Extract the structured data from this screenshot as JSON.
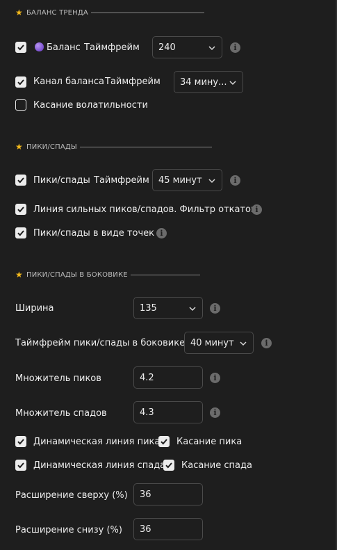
{
  "sections": {
    "trend_balance": "БАЛАНС ТРЕНДА",
    "peaks_troughs": "ПИКИ/СПАДЫ",
    "peaks_troughs_side": "ПИКИ/СПАДЫ В БОКОВИКЕ"
  },
  "rows": {
    "balance": {
      "label": "Баланс",
      "tf_label": "Таймфрейм",
      "value": "240",
      "checked": true
    },
    "balance_channel": {
      "label": "Канал баланса",
      "tf_label": "Таймфрейм",
      "value": "34 мину...",
      "checked": true
    },
    "volatility_touch": {
      "label": "Касание волатильности",
      "checked": false
    },
    "peaks": {
      "label": "Пики/спады",
      "tf_label": "Таймфрейм",
      "value": "45 минут",
      "checked": true
    },
    "strong_peaks": {
      "label": "Линия сильных пиков/спадов. Фильтр откатов",
      "checked": true
    },
    "peaks_dots": {
      "label": "Пики/спады в виде точек",
      "checked": true
    },
    "width": {
      "label": "Ширина",
      "value": "135"
    },
    "side_tf": {
      "label": "Таймфрейм пики/спады в боковике",
      "value": "40 минут"
    },
    "peak_mult": {
      "label": "Множитель пиков",
      "value": "4.2"
    },
    "trough_mult": {
      "label": "Множитель спадов",
      "value": "4.3"
    },
    "dyn_peak": {
      "label": "Динамическая линия пика",
      "checked": true
    },
    "peak_touch": {
      "label": "Касание пика",
      "checked": true
    },
    "dyn_trough": {
      "label": "Динамическая линия спада",
      "checked": true
    },
    "trough_touch": {
      "label": "Касание спада",
      "checked": true
    },
    "ext_top": {
      "label": "Расширение сверху (%)",
      "value": "36"
    },
    "ext_bottom": {
      "label": "Расширение снизу (%)",
      "value": "36"
    }
  },
  "icons": {
    "star": "star-icon",
    "info": "info-icon",
    "chevron": "chevron-down-icon",
    "check": "check-icon",
    "dot": "purple-dot-icon"
  },
  "colors": {
    "background": "#1e1e1e",
    "star": "#f2b81c",
    "dot": "#8a5cd9",
    "info": "#6b6b6b"
  }
}
